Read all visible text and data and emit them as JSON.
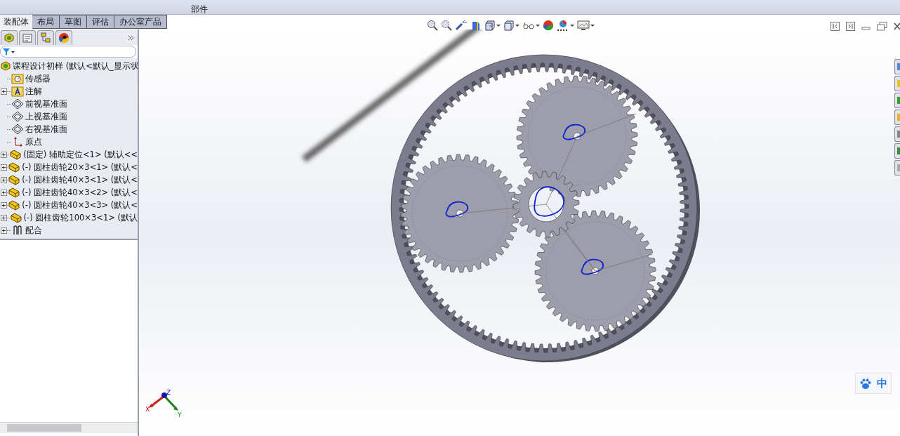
{
  "toolbar": {
    "labels": [
      "部件"
    ]
  },
  "tabs": [
    {
      "label": "装配体",
      "selected": true
    },
    {
      "label": "布局",
      "selected": false
    },
    {
      "label": "草图",
      "selected": false
    },
    {
      "label": "评估",
      "selected": false
    },
    {
      "label": "办公室产品",
      "selected": false
    }
  ],
  "tree": {
    "root": {
      "label": "课程设计初样  (默认<默认_显示状"
    },
    "items": [
      {
        "label": "传感器",
        "kind": "sensor",
        "expandable": false
      },
      {
        "label": "注解",
        "kind": "annotation",
        "expandable": true
      },
      {
        "label": "前视基准面",
        "kind": "plane",
        "expandable": false
      },
      {
        "label": "上视基准面",
        "kind": "plane",
        "expandable": false
      },
      {
        "label": "右视基准面",
        "kind": "plane",
        "expandable": false
      },
      {
        "label": "原点",
        "kind": "origin",
        "expandable": false
      },
      {
        "label": "(固定) 辅助定位<1> (默认<<",
        "kind": "part",
        "expandable": true
      },
      {
        "label": "(-) 圆柱齿轮20×3<1> (默认<",
        "kind": "part",
        "expandable": true
      },
      {
        "label": "(-) 圆柱齿轮40×3<1> (默认<",
        "kind": "part",
        "expandable": true
      },
      {
        "label": "(-) 圆柱齿轮40×3<2> (默认<",
        "kind": "part",
        "expandable": true
      },
      {
        "label": "(-) 圆柱齿轮40×3<3> (默认<",
        "kind": "part",
        "expandable": true
      },
      {
        "label": "(-) 圆柱齿轮100×3<1> (默认",
        "kind": "part",
        "expandable": true
      },
      {
        "label": "配合",
        "kind": "mates",
        "expandable": true
      }
    ]
  },
  "triad": {
    "x": "X",
    "y": "Y",
    "z": "Z"
  },
  "ime": {
    "label": "中"
  }
}
